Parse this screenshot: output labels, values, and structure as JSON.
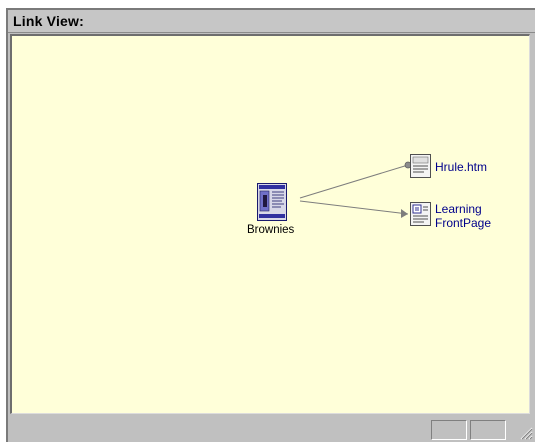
{
  "window": {
    "title": "Link View:"
  },
  "nodes": {
    "center": {
      "label": "Brownies",
      "icon": "page-document-icon"
    },
    "links": [
      {
        "line1": "Hrule.htm",
        "line2": "",
        "icon": "html-page-icon"
      },
      {
        "line1": "Learning",
        "line2": "FrontPage",
        "icon": "web-page-icon"
      }
    ]
  },
  "colors": {
    "pane_background": "#ffffd9",
    "link_text": "#00008b",
    "chrome": "#c0c0c0"
  }
}
